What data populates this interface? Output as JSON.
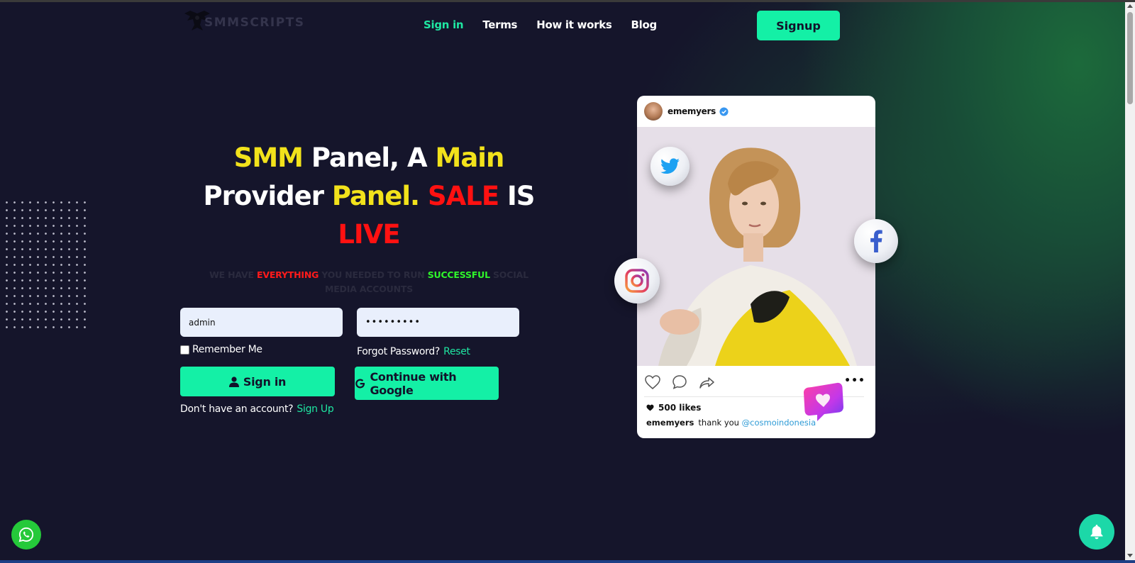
{
  "brand": {
    "name": "SMMSCRIPTS",
    "icon": "eagle-logo-icon"
  },
  "nav": {
    "items": [
      {
        "label": "Sign in",
        "active": true
      },
      {
        "label": "Terms",
        "active": false
      },
      {
        "label": "How it works",
        "active": false
      },
      {
        "label": "Blog",
        "active": false
      }
    ],
    "signup_label": "Signup"
  },
  "hero": {
    "title_parts": [
      "SMM",
      " Panel, A ",
      "Main",
      " Provider ",
      "Panel.",
      " ",
      "SALE",
      " IS ",
      "LIVE"
    ],
    "subtitle_parts": [
      "WE HAVE ",
      "EVERYTHING",
      " YOU NEEDED TO RUN ",
      "SUCCESSFUL",
      " SOCIAL MEDIA ACCOUNTS"
    ]
  },
  "login": {
    "username_value": "admin",
    "password_value": "•••••••••",
    "remember_label": "Remember Me",
    "forgot_label": "Forgot Password?",
    "reset_label": "Reset",
    "signin_label": "Sign in",
    "google_label": "Continue with Google",
    "no_account_label": "Don't have an account?",
    "signup_link_label": "Sign Up"
  },
  "post": {
    "username": "ememyers",
    "likes": "500 likes",
    "caption_user": "ememyers",
    "caption_text": "thank you",
    "caption_mention": "@cosmoindonesia"
  },
  "colors": {
    "accent": "#14f0a6",
    "background": "#15152b",
    "yellow": "#f2e21b",
    "red": "#ff1111",
    "green_text": "#2ff52a"
  },
  "icons": [
    "twitter-icon",
    "facebook-icon",
    "instagram-icon",
    "heart-3d-icon",
    "whatsapp-icon",
    "bell-icon",
    "user-icon",
    "google-icon"
  ]
}
